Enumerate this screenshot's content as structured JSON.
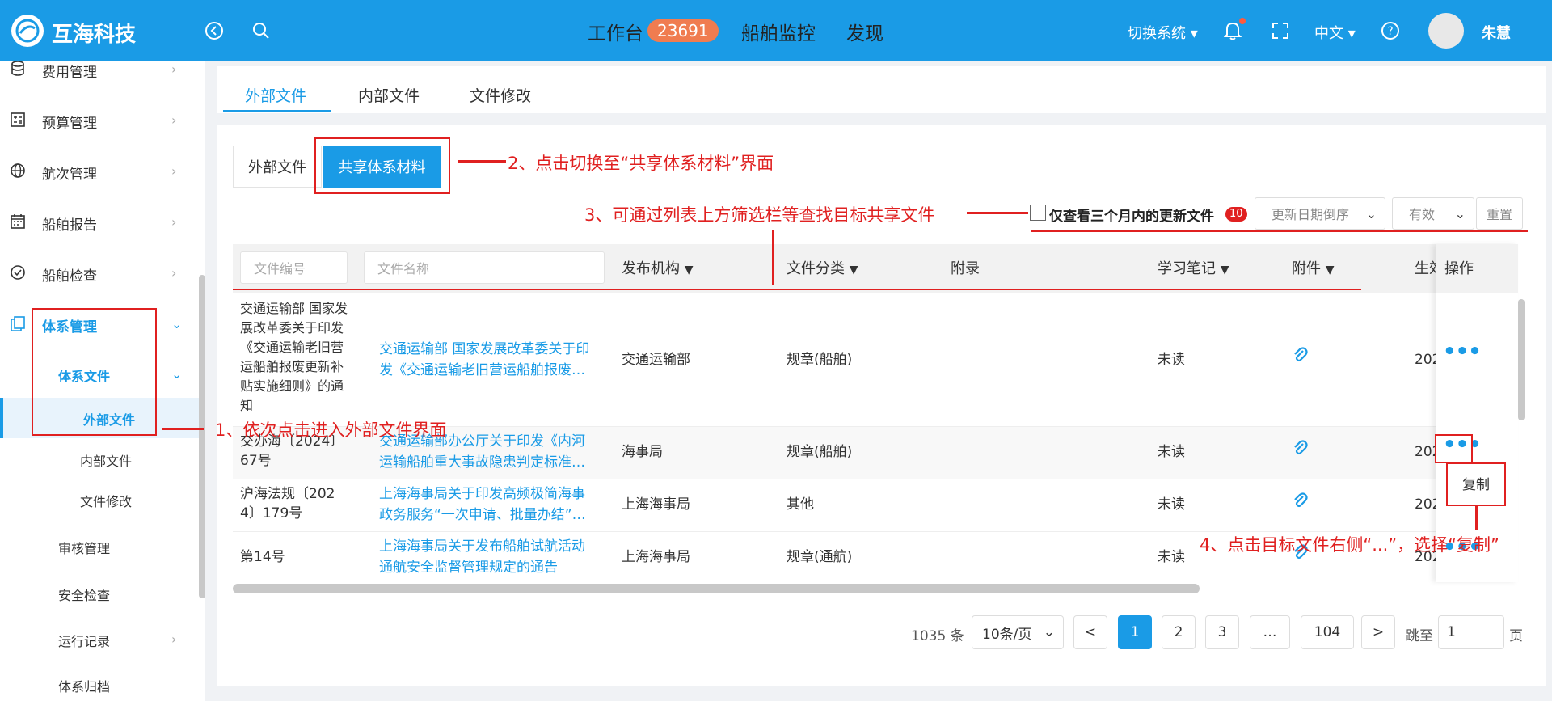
{
  "header": {
    "app_name": "互海科技",
    "nav": [
      "工作台",
      "船舶监控",
      "发现"
    ],
    "workbench_count": "23691",
    "switch_system": "切换系统",
    "language": "中文",
    "user_name": "朱慧"
  },
  "sidebar": {
    "items": [
      {
        "label": "费用管理",
        "icon": "database-icon"
      },
      {
        "label": "预算管理",
        "icon": "calculator-icon"
      },
      {
        "label": "航次管理",
        "icon": "globe-icon"
      },
      {
        "label": "船舶报告",
        "icon": "calendar-icon"
      },
      {
        "label": "船舶检查",
        "icon": "check-circle-icon"
      },
      {
        "label": "体系管理",
        "icon": "document-copy-icon"
      }
    ],
    "sub_group": "体系文件",
    "sub_items": [
      "外部文件",
      "内部文件",
      "文件修改"
    ],
    "more_items": [
      "审核管理",
      "安全检查",
      "运行记录",
      "体系归档"
    ]
  },
  "tabs": [
    "外部文件",
    "内部文件",
    "文件修改"
  ],
  "segment": [
    "外部文件",
    "共享体系材料"
  ],
  "filters": {
    "only_recent_label": "仅查看三个月内的更新文件",
    "recent_badge": "10",
    "sort_value": "更新日期倒序",
    "status_value": "有效",
    "reset_label": "重置"
  },
  "table": {
    "placeholders": {
      "file_no": "文件编号",
      "file_name": "文件名称"
    },
    "headers": [
      "发布机构",
      "文件分类",
      "附录",
      "学习笔记",
      "附件",
      "生效",
      "操作"
    ],
    "rows": [
      {
        "no": "交通运输部 国家发展改革委关于印发《交通运输老旧营运船舶报废更新补贴实施细则》的通知",
        "name_1": "交通运输部 国家发展改革委关于印",
        "name_2": "发《交通运输老旧营运船舶报废…",
        "org": "交通运输部",
        "category": "规章(船舶)",
        "note": "未读",
        "date": "202"
      },
      {
        "no_1": "交办海〔2024〕",
        "no_2": "67号",
        "name_1": "交通运输部办公厅关于印发《内河",
        "name_2": "运输船舶重大事故隐患判定标准…",
        "org": "海事局",
        "category": "规章(船舶)",
        "note": "未读",
        "date": "202"
      },
      {
        "no_1": "沪海法规〔202",
        "no_2": "4〕179号",
        "name_1": "上海海事局关于印发高频极简海事",
        "name_2": "政务服务“一次申请、批量办结”…",
        "org": "上海海事局",
        "category": "其他",
        "note": "未读",
        "date": "202"
      },
      {
        "no": "第14号",
        "name_1": "上海海事局关于发布船舶试航活动",
        "name_2": "通航安全监督管理规定的通告",
        "org": "上海海事局",
        "category": "规章(通航)",
        "note": "未读",
        "date": "202"
      }
    ],
    "copy_label": "复制"
  },
  "pagination": {
    "total": "1035 条",
    "page_size": "10条/页",
    "prev": "<",
    "next": ">",
    "pages": [
      "1",
      "2",
      "3",
      "…",
      "104"
    ],
    "jump_label": "跳至",
    "jump_value": "1",
    "page_unit": "页"
  },
  "annotations": {
    "step1": "1、依次点击进入外部文件界面",
    "step2": "2、点击切换至“共享体系材料”界面",
    "step3": "3、可通过列表上方筛选栏等查找目标共享文件",
    "step4": "4、点击目标文件右侧“...”，选择“复制”"
  },
  "colors": {
    "primary": "#1a9be6",
    "annotation": "#e02020",
    "badge": "#f07c50"
  }
}
